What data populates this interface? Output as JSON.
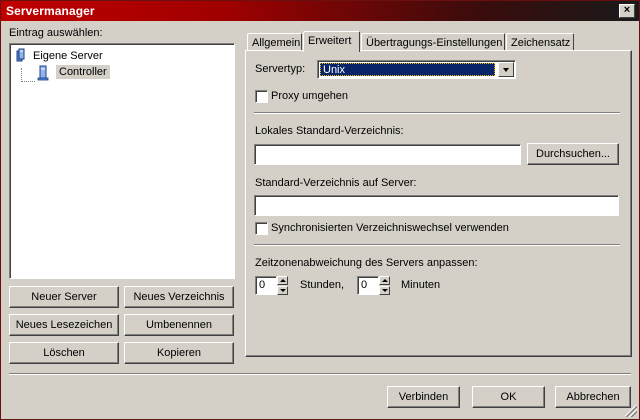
{
  "window": {
    "title": "Servermanager",
    "close_label": "×"
  },
  "left": {
    "prompt": "Eintrag auswählen:",
    "tree": {
      "root": "Eigene Server",
      "child": "Controller"
    },
    "buttons": {
      "new_server": "Neuer Server",
      "new_folder": "Neues Verzeichnis",
      "new_bookmark": "Neues Lesezeichen",
      "rename": "Umbenennen",
      "delete": "Löschen",
      "copy": "Kopieren"
    }
  },
  "tabs": [
    "Allgemein",
    "Erweitert",
    "Übertragungs-Einstellungen",
    "Zeichensatz"
  ],
  "active_tab": "Erweitert",
  "advanced": {
    "server_type_label": "Servertyp:",
    "server_type_value": "Unix",
    "proxy_bypass_label": "Proxy umgehen",
    "proxy_bypass_checked": false,
    "local_dir_label": "Lokales Standard-Verzeichnis:",
    "local_dir_value": "",
    "browse_label": "Durchsuchen...",
    "remote_dir_label": "Standard-Verzeichnis auf Server:",
    "remote_dir_value": "",
    "sync_browse_label": "Synchronisierten Verzeichniswechsel verwenden",
    "sync_browse_checked": false,
    "timezone_label": "Zeitzonenabweichung des Servers anpassen:",
    "hours_value": "0",
    "hours_label": "Stunden,",
    "minutes_value": "0",
    "minutes_label": "Minuten"
  },
  "footer": {
    "connect": "Verbinden",
    "ok": "OK",
    "cancel": "Abbrechen"
  },
  "colors": {
    "title_start": "#c00000",
    "title_end": "#1a1a1a",
    "selection": "#0a246a",
    "face": "#d4d0c8"
  }
}
